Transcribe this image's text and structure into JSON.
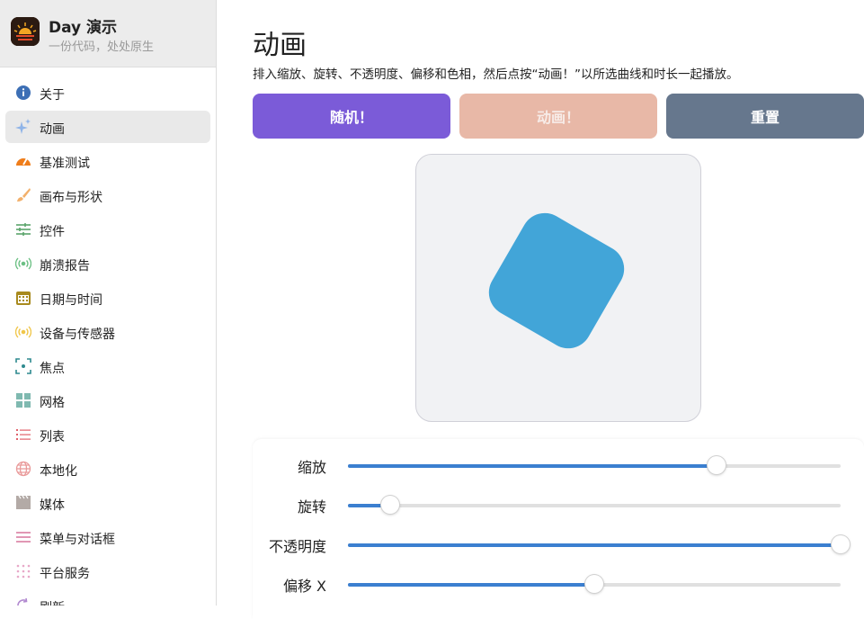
{
  "app": {
    "title": "Day 演示",
    "subtitle": "一份代码，处处原生"
  },
  "sidebar": {
    "items": [
      {
        "label": "关于",
        "icon": "info-icon"
      },
      {
        "label": "动画",
        "icon": "sparkles-icon",
        "active": true
      },
      {
        "label": "基准测试",
        "icon": "speedometer-icon"
      },
      {
        "label": "画布与形状",
        "icon": "brush-icon"
      },
      {
        "label": "控件",
        "icon": "sliders-icon"
      },
      {
        "label": "崩溃报告",
        "icon": "broadcast-icon"
      },
      {
        "label": "日期与时间",
        "icon": "calendar-icon"
      },
      {
        "label": "设备与传感器",
        "icon": "sensor-icon"
      },
      {
        "label": "焦点",
        "icon": "focus-icon"
      },
      {
        "label": "网格",
        "icon": "grid-icon"
      },
      {
        "label": "列表",
        "icon": "list-icon"
      },
      {
        "label": "本地化",
        "icon": "globe-icon"
      },
      {
        "label": "媒体",
        "icon": "film-icon"
      },
      {
        "label": "菜单与对话框",
        "icon": "menu-icon"
      },
      {
        "label": "平台服务",
        "icon": "dots-grid-icon"
      },
      {
        "label": "刷新",
        "icon": "refresh-icon"
      }
    ]
  },
  "main": {
    "title": "动画",
    "description": "排入缩放、旋转、不透明度、偏移和色相，然后点按“动画！”以所选曲线和时长一起播放。",
    "buttons": {
      "random": "随机！",
      "animate": "动画！",
      "reset": "重置"
    },
    "sliders": [
      {
        "label": "缩放",
        "fraction": 0.748
      },
      {
        "label": "旋转",
        "fraction": 0.085
      },
      {
        "label": "不透明度",
        "fraction": 1.0
      },
      {
        "label": "偏移 X",
        "fraction": 0.5
      }
    ]
  },
  "colors": {
    "random_button": "#7b5bd8",
    "animate_button": "#e8b8a7",
    "reset_button": "#66778d",
    "shape": "#42a5d8",
    "slider_fill": "#3b7fd0"
  }
}
